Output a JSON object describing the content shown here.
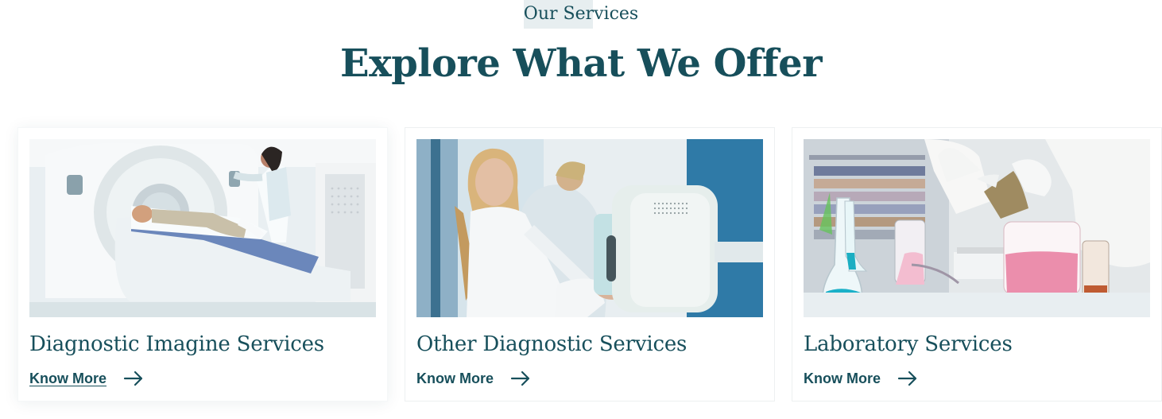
{
  "section": {
    "eyebrow": "Our Services",
    "title": "Explore What We Offer"
  },
  "cards": [
    {
      "title": "Diagnostic Imagine Services",
      "link": "Know More",
      "image": "ct-scanner-photo",
      "arrow_icon": "arrow-right-icon"
    },
    {
      "title": "Other Diagnostic  Services",
      "link": "Know More",
      "image": "xray-technician-photo",
      "arrow_icon": "arrow-right-icon"
    },
    {
      "title": "Laboratory Services",
      "link": "Know More",
      "image": "laboratory-photo",
      "arrow_icon": "arrow-right-icon"
    }
  ],
  "colors": {
    "primary": "#174f5b",
    "eyebrow_background": "#e7eef0",
    "card_border": "#edf0f1"
  }
}
